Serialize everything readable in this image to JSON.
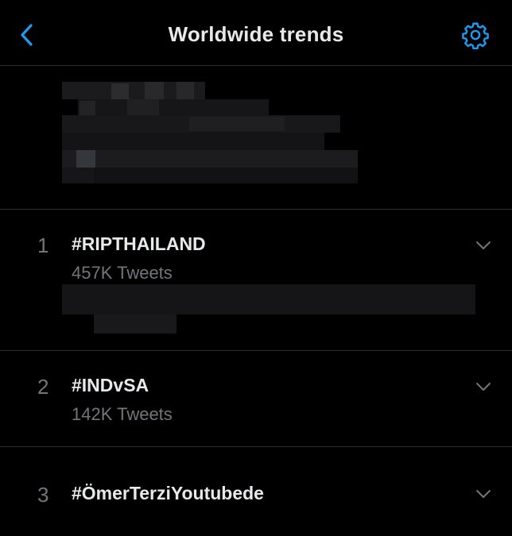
{
  "header": {
    "title": "Worldwide trends",
    "back_icon": "chevron-left-icon",
    "settings_icon": "gear-icon"
  },
  "colors": {
    "accent": "#1d9bf0",
    "background": "#000000",
    "text_primary": "#e7e9ea",
    "text_secondary": "#71767b",
    "divider": "#2a2d31"
  },
  "trends": [
    {
      "rank": "1",
      "name": "#RIPTHAILAND",
      "count": "457K Tweets",
      "menu_icon": "chevron-down-icon"
    },
    {
      "rank": "2",
      "name": "#INDvSA",
      "count": "142K Tweets",
      "menu_icon": "chevron-down-icon"
    },
    {
      "rank": "3",
      "name": "#ÖmerTerziYoutubede",
      "count": "",
      "menu_icon": "chevron-down-icon"
    }
  ]
}
